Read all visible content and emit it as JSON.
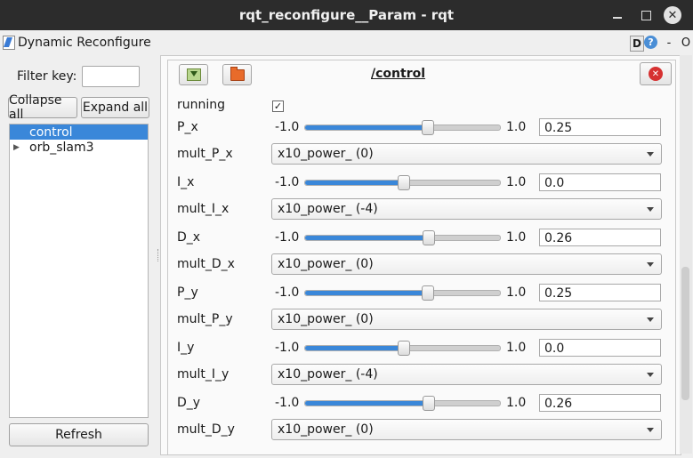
{
  "window": {
    "title": "rqt_reconfigure__Param - rqt"
  },
  "plugin": {
    "title": "Dynamic Reconfigure",
    "d_label": "D",
    "help_label": "?",
    "dash_label": "-",
    "o_label": "O"
  },
  "left": {
    "filter_label": "Filter key:",
    "filter_value": "",
    "collapse_label": "Collapse all",
    "expand_label": "Expand all",
    "tree": [
      {
        "label": "control",
        "selected": true,
        "expandable": false
      },
      {
        "label": "orb_slam3",
        "selected": false,
        "expandable": true
      }
    ],
    "refresh_label": "Refresh"
  },
  "node": {
    "title": "/control"
  },
  "params": {
    "running": {
      "label": "running",
      "checked": true,
      "check_glyph": "✓"
    },
    "P_x": {
      "label": "P_x",
      "min": "-1.0",
      "max": "1.0",
      "value": "0.25",
      "fraction": 0.625
    },
    "mult_P_x": {
      "label": "mult_P_x",
      "selected": "x10_power_ (0)"
    },
    "I_x": {
      "label": "I_x",
      "min": "-1.0",
      "max": "1.0",
      "value": "0.0",
      "fraction": 0.5
    },
    "mult_I_x": {
      "label": "mult_I_x",
      "selected": "x10_power_ (-4)"
    },
    "D_x": {
      "label": "D_x",
      "min": "-1.0",
      "max": "1.0",
      "value": "0.26",
      "fraction": 0.63
    },
    "mult_D_x": {
      "label": "mult_D_x",
      "selected": "x10_power_ (0)"
    },
    "P_y": {
      "label": "P_y",
      "min": "-1.0",
      "max": "1.0",
      "value": "0.25",
      "fraction": 0.625
    },
    "mult_P_y": {
      "label": "mult_P_y",
      "selected": "x10_power_ (0)"
    },
    "I_y": {
      "label": "I_y",
      "min": "-1.0",
      "max": "1.0",
      "value": "0.0",
      "fraction": 0.5
    },
    "mult_I_y": {
      "label": "mult_I_y",
      "selected": "x10_power_ (-4)"
    },
    "D_y": {
      "label": "D_y",
      "min": "-1.0",
      "max": "1.0",
      "value": "0.26",
      "fraction": 0.63
    },
    "mult_D_y": {
      "label": "mult_D_y",
      "selected": "x10_power_ (0)"
    }
  }
}
